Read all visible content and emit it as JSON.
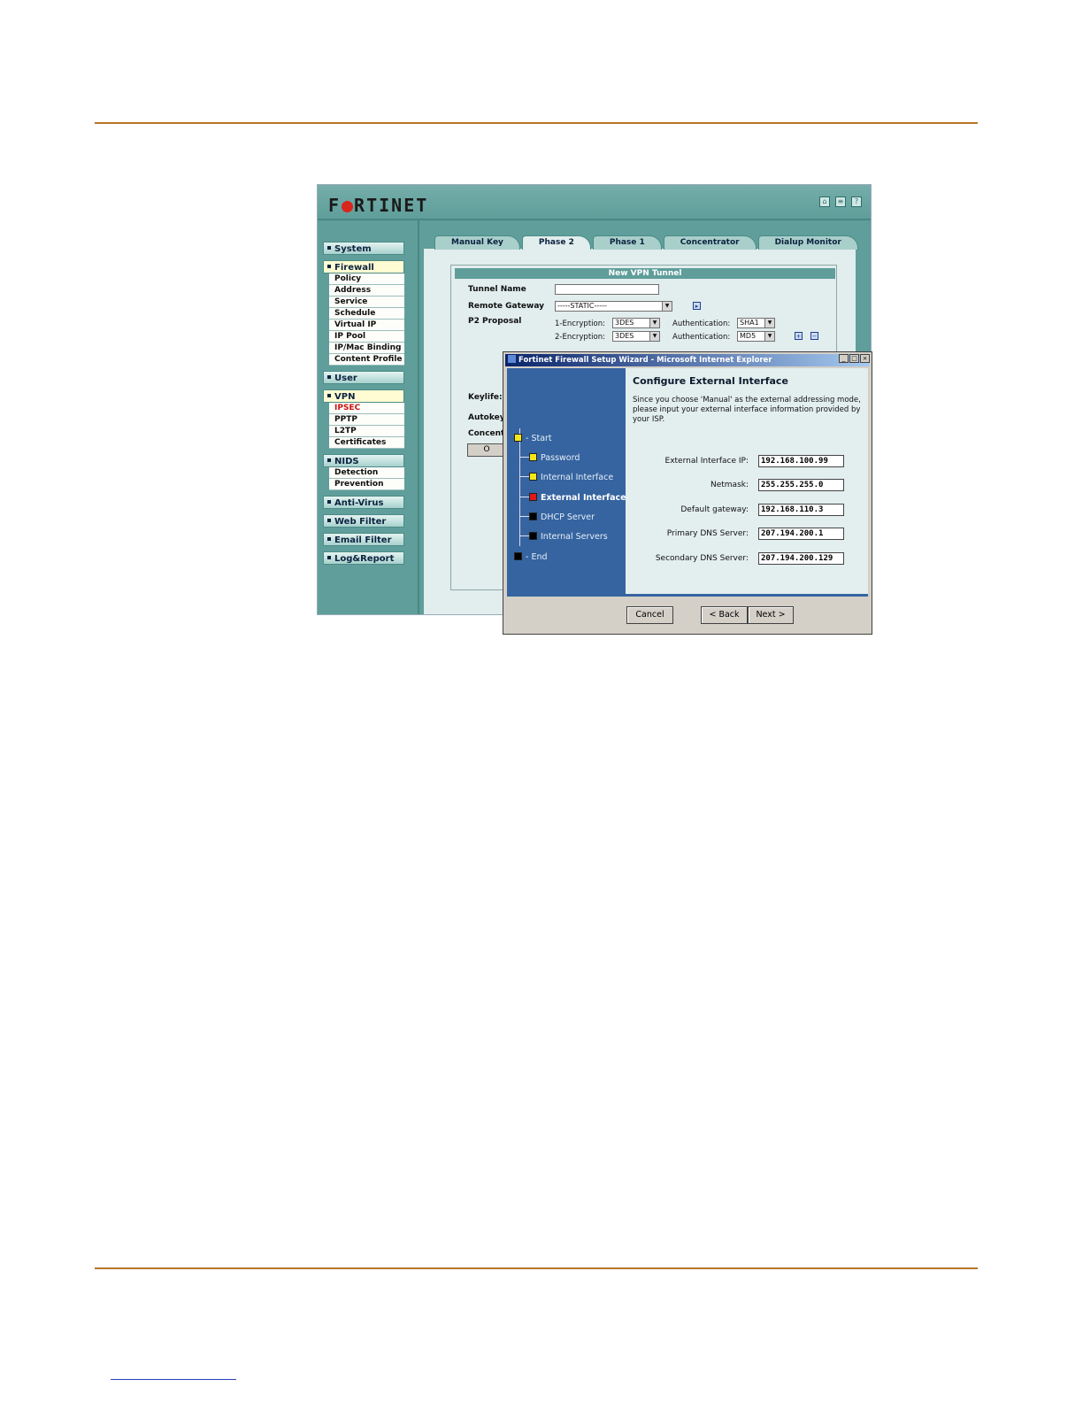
{
  "app": {
    "brand": "FORTINET",
    "nav": [
      {
        "label": "System",
        "items": []
      },
      {
        "label": "Firewall",
        "items": [
          "Policy",
          "Address",
          "Service",
          "Schedule",
          "Virtual IP",
          "IP Pool",
          "IP/Mac Binding",
          "Content Profile"
        ]
      },
      {
        "label": "User",
        "items": []
      },
      {
        "label": "VPN",
        "items": [
          "IPSEC",
          "PPTP",
          "L2TP",
          "Certificates"
        ]
      },
      {
        "label": "NIDS",
        "items": [
          "Detection",
          "Prevention"
        ]
      },
      {
        "label": "Anti-Virus",
        "items": []
      },
      {
        "label": "Web Filter",
        "items": []
      },
      {
        "label": "Email Filter",
        "items": []
      },
      {
        "label": "Log&Report",
        "items": []
      }
    ],
    "tabs": [
      "Manual Key",
      "Phase 2",
      "Phase 1",
      "Concentrator",
      "Dialup Monitor"
    ],
    "form": {
      "title": "New VPN Tunnel",
      "tunnel_name_label": "Tunnel Name",
      "tunnel_name_value": "",
      "remote_gateway_label": "Remote Gateway",
      "remote_gateway_value": "-----STATIC-----",
      "p2_proposal_label": "P2 Proposal",
      "enc1_label": "1-Encryption:",
      "enc1_value": "3DES",
      "auth1_label": "Authentication:",
      "auth1_value": "SHA1",
      "enc2_label": "2-Encryption:",
      "enc2_value": "3DES",
      "auth2_label": "Authentication:",
      "auth2_value": "MD5",
      "keylife_label": "Keylife:",
      "autokey_label": "Autokey",
      "concent_label": "Concent",
      "ok_label": "O"
    }
  },
  "wizard": {
    "window_title": "Fortinet Firewall Setup Wizard - Microsoft Internet Explorer",
    "steps": [
      {
        "label": "Start",
        "color": "#f5e61c"
      },
      {
        "label": "Password",
        "color": "#f5e61c"
      },
      {
        "label": "Internal Interface",
        "color": "#f5e61c"
      },
      {
        "label": "External Interface",
        "color": "#e01818"
      },
      {
        "label": "DHCP Server",
        "color": "#000000"
      },
      {
        "label": "Internal Servers",
        "color": "#000000"
      },
      {
        "label": "End",
        "color": "#000000"
      }
    ],
    "heading": "Configure External Interface",
    "description": "Since you choose 'Manual' as the external addressing mode, please input your external interface information provided by your ISP.",
    "fields": [
      {
        "label": "External Interface IP:",
        "value": "192.168.100.99"
      },
      {
        "label": "Netmask:",
        "value": "255.255.255.0"
      },
      {
        "label": "Default gateway:",
        "value": "192.168.110.3"
      },
      {
        "label": "Primary DNS Server:",
        "value": "207.194.200.1"
      },
      {
        "label": "Secondary DNS Server:",
        "value": "207.194.200.129"
      }
    ],
    "buttons": {
      "cancel": "Cancel",
      "back": "<  Back",
      "next": "Next  >"
    }
  }
}
